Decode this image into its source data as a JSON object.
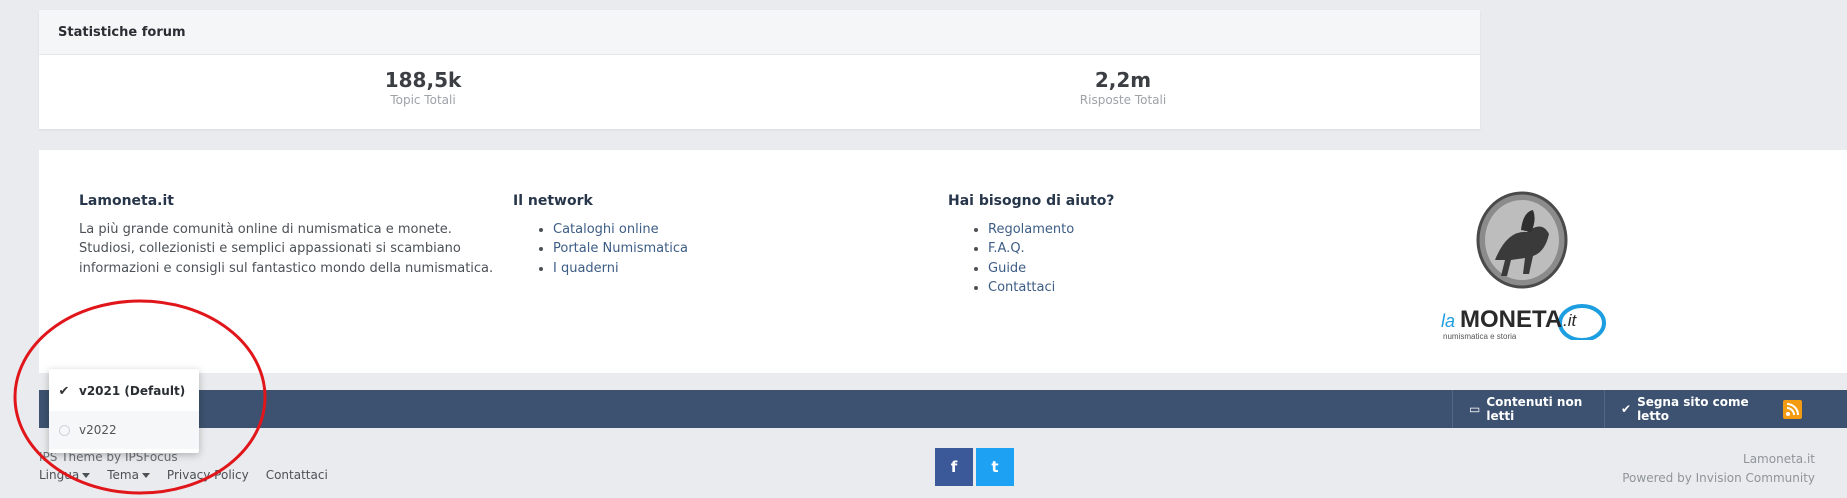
{
  "stats": {
    "title": "Statistiche forum",
    "items": [
      {
        "value": "188,5k",
        "label": "Topic Totali"
      },
      {
        "value": "2,2m",
        "label": "Risposte Totali"
      }
    ]
  },
  "footer": {
    "about": {
      "title": "Lamoneta.it",
      "lines": [
        "La più grande comunità online di numismatica e monete.",
        "Studiosi, collezionisti e semplici appassionati si scambiano",
        "informazioni e consigli sul fantastico mondo della numismatica."
      ]
    },
    "network": {
      "title": "Il network",
      "links": [
        "Cataloghi online",
        "Portale Numismatica",
        "I quaderni"
      ]
    },
    "help": {
      "title": "Hai bisogno di aiuto?",
      "links": [
        "Regolamento",
        "F.A.Q.",
        "Guide",
        "Contattaci"
      ]
    },
    "logo": {
      "brand_la": "la",
      "brand_moneta": "MONETA",
      "brand_it": ".it",
      "tagline": "numismatica e storia"
    }
  },
  "navbar": {
    "unread": "Contenuti non letti",
    "mark_read": "Segna sito come letto"
  },
  "dropdown": {
    "options": [
      "v2021 (Default)",
      "v2022"
    ],
    "selected": "v2021 (Default)"
  },
  "bottom": {
    "theme_credit": "IPS Theme by IPSFocus",
    "links": [
      "Lingua",
      "Tema",
      "Privacy Policy",
      "Contattaci"
    ],
    "site_name": "Lamoneta.it",
    "powered_by": "Powered by Invision Community",
    "social": {
      "facebook": "f",
      "twitter": "t"
    }
  },
  "colors": {
    "navbar": "#3d5270",
    "accent_link": "#3d5d85",
    "annotation": "#e0161b",
    "rss": "#f39c12"
  }
}
